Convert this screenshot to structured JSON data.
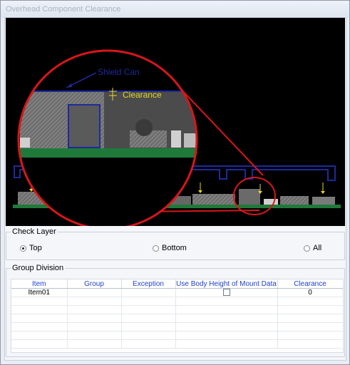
{
  "window": {
    "title": "Overhead Component Clearance"
  },
  "diagram": {
    "shield_label": "Shield Can",
    "clearance_label": "Clearance"
  },
  "check_layer": {
    "label": "Check Layer",
    "options": [
      {
        "label": "Top",
        "selected": true
      },
      {
        "label": "Bottom",
        "selected": false
      },
      {
        "label": "All",
        "selected": false
      }
    ]
  },
  "group_division": {
    "label": "Group Division",
    "columns": [
      "Item",
      "Group",
      "Exception",
      "Use Body Height of Mount Data",
      "Clearance"
    ],
    "rows": [
      {
        "item": "Item01",
        "group": "",
        "exception": "",
        "use_body_height": false,
        "clearance": "0"
      }
    ]
  },
  "colors": {
    "header_text": "#1f3fd0",
    "magnifier": "#d8161a",
    "shield": "#1d2a9c",
    "clearance": "#e6d72a"
  }
}
